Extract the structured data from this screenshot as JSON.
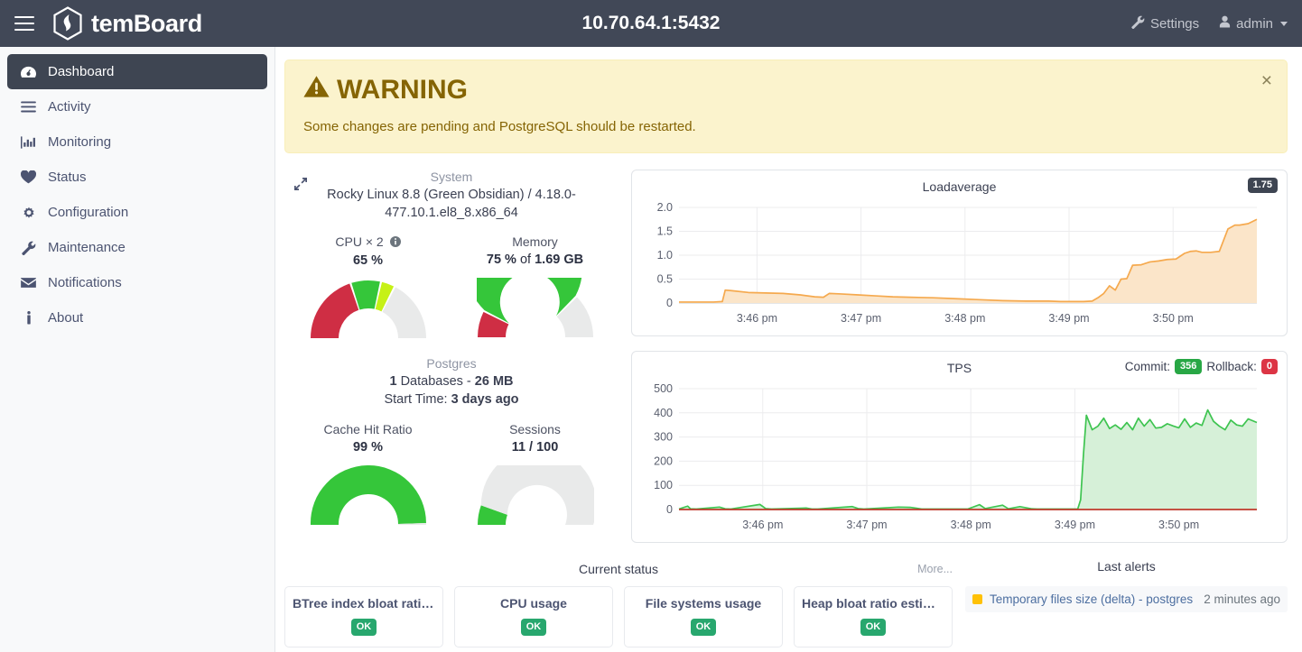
{
  "header": {
    "brand": "temBoard",
    "title": "10.70.64.1:5432",
    "settings_label": "Settings",
    "user_label": "admin",
    "menu_icon": "hamburger-menu-icon",
    "logo_icon": "temboard-logo-icon",
    "settings_icon": "wrench-icon",
    "user_icon": "user-icon"
  },
  "sidebar": {
    "items": [
      {
        "label": "Dashboard",
        "icon": "dashboard-icon",
        "active": true
      },
      {
        "label": "Activity",
        "icon": "list-icon",
        "active": false
      },
      {
        "label": "Monitoring",
        "icon": "bar-chart-icon",
        "active": false
      },
      {
        "label": "Status",
        "icon": "heart-icon",
        "active": false
      },
      {
        "label": "Configuration",
        "icon": "gear-icon",
        "active": false
      },
      {
        "label": "Maintenance",
        "icon": "wrench-icon",
        "active": false
      },
      {
        "label": "Notifications",
        "icon": "envelope-icon",
        "active": false
      },
      {
        "label": "About",
        "icon": "info-icon",
        "active": false
      }
    ]
  },
  "alert_banner": {
    "severity": "WARNING",
    "icon": "warning-triangle-icon",
    "message": "Some changes are pending and PostgreSQL should be restarted.",
    "close_label": "×",
    "bg_color": "#fbf3cd",
    "text_color": "#856404"
  },
  "system_panel": {
    "expand_icon": "expand-arrows-icon",
    "title": "System",
    "description": "Rocky Linux 8.8 (Green Obsidian) / 4.18.0-477.10.1.el8_8.x86_64",
    "gauges": [
      {
        "label": "CPU × 2",
        "has_info_icon": true,
        "value_html": "65 %",
        "percent": 65,
        "segments": [
          {
            "from": 0,
            "to": 40,
            "color": "#cf2e44"
          },
          {
            "from": 40,
            "to": 57,
            "color": "#35c63a"
          },
          {
            "from": 57,
            "to": 65,
            "color": "#c6f116"
          },
          {
            "from": 65,
            "to": 100,
            "color": "#e9eaea"
          }
        ]
      },
      {
        "label": "Memory",
        "has_info_icon": false,
        "value_prefix": "75 %",
        "value_mid": " of ",
        "value_suffix": "1.69 GB",
        "percent": 75,
        "segments": [
          {
            "from": 0,
            "to": 15,
            "color": "#cf2e44"
          },
          {
            "from": 15,
            "to": 75,
            "color": "#35c63a"
          },
          {
            "from": 75,
            "to": 100,
            "color": "#e9eaea"
          }
        ]
      }
    ]
  },
  "postgres_panel": {
    "title": "Postgres",
    "databases_count": "1",
    "databases_word": " Databases - ",
    "databases_size": "26 MB",
    "start_time_label": "Start Time: ",
    "start_time_value": "3 days ago",
    "gauges": [
      {
        "label": "Cache Hit Ratio",
        "value_html": "99 %",
        "percent": 99,
        "segments": [
          {
            "from": 0,
            "to": 99,
            "color": "#35c63a"
          },
          {
            "from": 99,
            "to": 100,
            "color": "#e9eaea"
          }
        ]
      },
      {
        "label": "Sessions",
        "value_html": "11 / 100",
        "percent": 11,
        "segments": [
          {
            "from": 0,
            "to": 11,
            "color": "#35c63a"
          },
          {
            "from": 11,
            "to": 100,
            "color": "#e9eaea"
          }
        ]
      }
    ]
  },
  "chart_data": [
    {
      "type": "area",
      "name": "loadaverage",
      "title": "Loadaverage",
      "badge_label": "1.75",
      "badge_color": "#3e4552",
      "xlabel": "",
      "ylabel": "",
      "ylim": [
        0,
        2.0
      ],
      "yticks": [
        "0",
        "0.5",
        "1.0",
        "1.5",
        "2.0"
      ],
      "ytick_values": [
        0,
        0.5,
        1.0,
        1.5,
        2.0
      ],
      "xticks": [
        "3:46 pm",
        "3:47 pm",
        "3:48 pm",
        "3:49 pm",
        "3:50 pm"
      ],
      "xtick_positions": [
        0.135,
        0.315,
        0.495,
        0.675,
        0.855
      ],
      "grid": true,
      "line_color": "#f5a94e",
      "fill_color": "#fbe5c9",
      "series": [
        {
          "name": "loadaverage",
          "x": [
            0.0,
            0.03,
            0.06,
            0.075,
            0.08,
            0.09,
            0.12,
            0.15,
            0.18,
            0.21,
            0.235,
            0.25,
            0.26,
            0.28,
            0.31,
            0.34,
            0.37,
            0.4,
            0.44,
            0.48,
            0.52,
            0.56,
            0.6,
            0.64,
            0.66,
            0.68,
            0.7,
            0.715,
            0.725,
            0.735,
            0.745,
            0.755,
            0.765,
            0.775,
            0.785,
            0.8,
            0.815,
            0.83,
            0.845,
            0.86,
            0.875,
            0.885,
            0.895,
            0.905,
            0.92,
            0.935,
            0.95,
            0.962,
            0.97,
            0.985,
            1.0
          ],
          "y": [
            0.02,
            0.02,
            0.02,
            0.03,
            0.27,
            0.26,
            0.22,
            0.21,
            0.2,
            0.17,
            0.13,
            0.12,
            0.2,
            0.19,
            0.17,
            0.15,
            0.13,
            0.12,
            0.11,
            0.09,
            0.07,
            0.05,
            0.04,
            0.04,
            0.03,
            0.03,
            0.03,
            0.04,
            0.11,
            0.2,
            0.36,
            0.27,
            0.5,
            0.51,
            0.79,
            0.8,
            0.86,
            0.88,
            0.91,
            0.92,
            1.04,
            1.08,
            1.09,
            1.06,
            1.06,
            1.08,
            1.55,
            1.63,
            1.63,
            1.66,
            1.75
          ]
        }
      ]
    },
    {
      "type": "area",
      "name": "tps",
      "title": "TPS",
      "legend": [
        {
          "label": "Commit:",
          "value": "356",
          "color": "#28a745"
        },
        {
          "label": "Rollback:",
          "value": "0",
          "color": "#dc3545"
        }
      ],
      "xlabel": "",
      "ylabel": "",
      "ylim": [
        0,
        500
      ],
      "yticks": [
        "0",
        "100",
        "200",
        "300",
        "400",
        "500"
      ],
      "ytick_values": [
        0,
        100,
        200,
        300,
        400,
        500
      ],
      "xticks": [
        "3:46 pm",
        "3:47 pm",
        "3:48 pm",
        "3:49 pm",
        "3:50 pm"
      ],
      "xtick_positions": [
        0.145,
        0.325,
        0.505,
        0.685,
        0.865
      ],
      "grid": true,
      "series": [
        {
          "name": "Commit",
          "color": "#3ec450",
          "fill": "#d6f0d8",
          "x": [
            0.0,
            0.015,
            0.02,
            0.03,
            0.07,
            0.08,
            0.09,
            0.14,
            0.15,
            0.16,
            0.22,
            0.23,
            0.24,
            0.3,
            0.31,
            0.32,
            0.38,
            0.4,
            0.42,
            0.5,
            0.52,
            0.53,
            0.56,
            0.57,
            0.59,
            0.61,
            0.62,
            0.66,
            0.69,
            0.695,
            0.7,
            0.705,
            0.715,
            0.725,
            0.735,
            0.745,
            0.755,
            0.765,
            0.775,
            0.785,
            0.795,
            0.805,
            0.815,
            0.825,
            0.835,
            0.845,
            0.855,
            0.865,
            0.875,
            0.885,
            0.895,
            0.905,
            0.915,
            0.925,
            0.935,
            0.945,
            0.955,
            0.965,
            0.975,
            0.985,
            1.0
          ],
          "y": [
            2,
            14,
            3,
            2,
            10,
            3,
            2,
            21,
            4,
            2,
            6,
            2,
            2,
            12,
            4,
            2,
            10,
            9,
            2,
            2,
            20,
            4,
            18,
            3,
            12,
            3,
            2,
            2,
            2,
            40,
            230,
            390,
            330,
            345,
            378,
            335,
            350,
            332,
            360,
            330,
            378,
            345,
            372,
            337,
            340,
            355,
            346,
            338,
            375,
            340,
            358,
            348,
            412,
            365,
            345,
            330,
            370,
            350,
            345,
            375,
            360
          ]
        },
        {
          "name": "Rollback",
          "color": "#c0392b",
          "fill": "transparent",
          "x": [
            0,
            1
          ],
          "y": [
            0,
            0
          ]
        }
      ]
    }
  ],
  "current_status": {
    "title": "Current status",
    "more_label": "More...",
    "cards": [
      {
        "name": "BTree index bloat ratio es...",
        "badge": "OK"
      },
      {
        "name": "CPU usage",
        "badge": "OK"
      },
      {
        "name": "File systems usage",
        "badge": "OK"
      },
      {
        "name": "Heap bloat ratio estimation",
        "badge": "OK"
      }
    ]
  },
  "last_alerts": {
    "title": "Last alerts",
    "rows": [
      {
        "name": "Temporary files size (delta) - postgres",
        "time": "2 minutes ago",
        "color": "#ffc107"
      }
    ]
  }
}
